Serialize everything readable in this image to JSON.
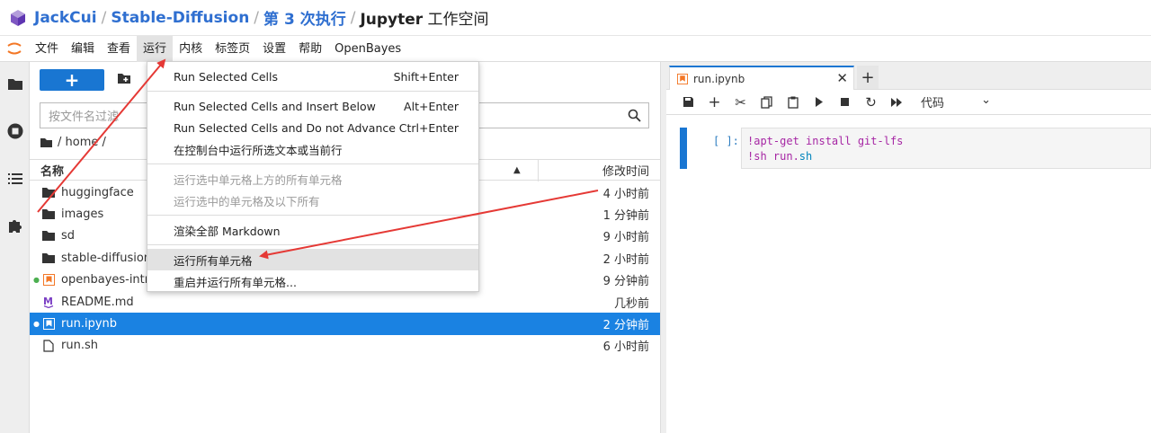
{
  "breadcrumb": {
    "user": "JackCui",
    "project": "Stable-Diffusion",
    "run": "第 3 次执行",
    "workspace_bold": "Jupyter",
    "workspace_light": " 工作空间"
  },
  "menubar": [
    "文件",
    "编辑",
    "查看",
    "运行",
    "内核",
    "标签页",
    "设置",
    "帮助",
    "OpenBayes"
  ],
  "run_menu": {
    "items": [
      {
        "label": "Run Selected Cells",
        "shortcut": "Shift+Enter"
      },
      {
        "label": "Run Selected Cells and Insert Below",
        "shortcut": "Alt+Enter"
      },
      {
        "label": "Run Selected Cells and Do not Advance",
        "shortcut": "Ctrl+Enter"
      },
      {
        "label": "在控制台中运行所选文本或当前行",
        "shortcut": ""
      },
      {
        "label": "运行选中单元格上方的所有单元格",
        "shortcut": ""
      },
      {
        "label": "运行选中的单元格及以下所有",
        "shortcut": ""
      },
      {
        "label": "渲染全部 Markdown",
        "shortcut": ""
      },
      {
        "label": "运行所有单元格",
        "shortcut": ""
      },
      {
        "label": "重启并运行所有单元格...",
        "shortcut": ""
      }
    ]
  },
  "filebrowser": {
    "new_label": "+",
    "filter_placeholder": "按文件名过滤",
    "path": "/ home /",
    "col_name": "名称",
    "col_modified": "修改时间",
    "files": [
      {
        "name": "huggingface",
        "time": "4 小时前",
        "type": "folder",
        "running": false
      },
      {
        "name": "images",
        "time": "1 分钟前",
        "type": "folder",
        "running": false
      },
      {
        "name": "sd",
        "time": "9 小时前",
        "type": "folder",
        "running": false
      },
      {
        "name": "stable-diffusion-",
        "time": "2 小时前",
        "type": "folder",
        "running": false
      },
      {
        "name": "openbayes-intro.",
        "time": "9 分钟前",
        "type": "notebook",
        "running": true
      },
      {
        "name": "README.md",
        "time": "几秒前",
        "type": "markdown",
        "running": false
      },
      {
        "name": "run.ipynb",
        "time": "2 分钟前",
        "type": "notebook",
        "running": true,
        "selected": true
      },
      {
        "name": "run.sh",
        "time": "6 小时前",
        "type": "file",
        "running": false
      }
    ]
  },
  "notebook": {
    "tab_label": "run.ipynb",
    "cell_type": "代码",
    "cell_prompt": "[ ]:",
    "code_line1_a": "!apt-get install git-lfs",
    "code_line2_a": "!sh run.",
    "code_line2_b": "sh"
  },
  "colors": {
    "accent": "#1976d2",
    "selected_row": "#1a82e2",
    "annotation": "#e53935"
  }
}
